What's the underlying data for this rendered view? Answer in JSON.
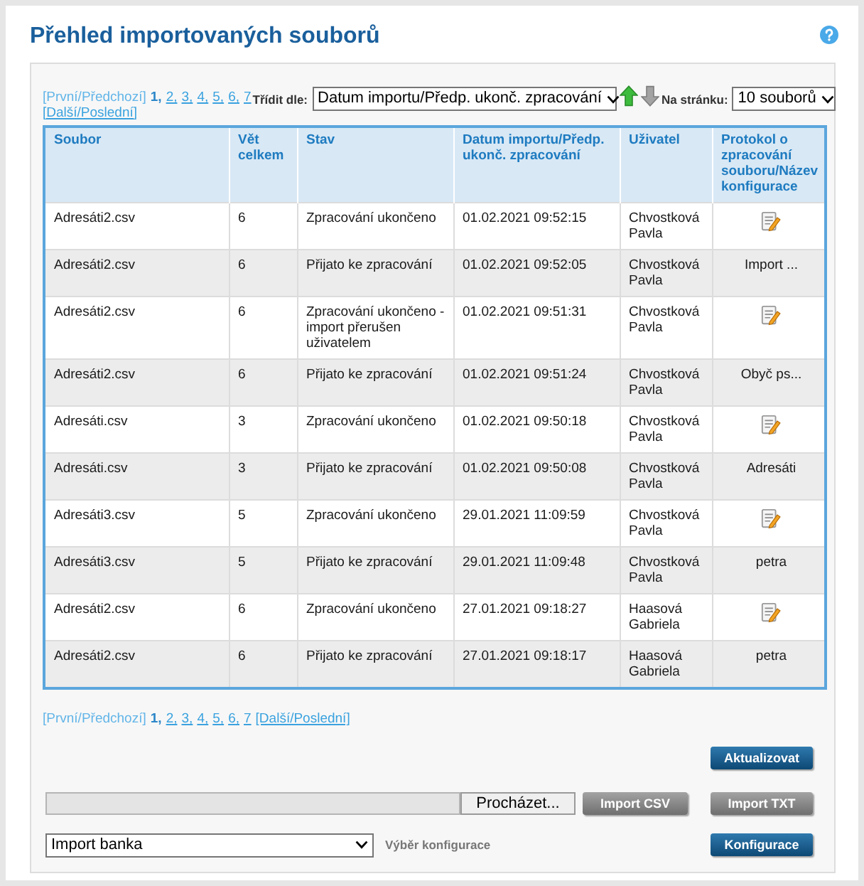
{
  "page": {
    "title": "Přehled importovaných souborů"
  },
  "toolbar": {
    "pagination": {
      "first_prev": {
        "label": "[První/Předchozí]",
        "disabled": true
      },
      "pages": [
        {
          "label": "1,",
          "selected": true
        },
        {
          "label": "2,",
          "selected": false
        },
        {
          "label": "3,",
          "selected": false
        },
        {
          "label": "4,",
          "selected": false
        },
        {
          "label": "5,",
          "selected": false
        },
        {
          "label": "6,",
          "selected": false
        },
        {
          "label": "7",
          "selected": false
        }
      ],
      "next_last": {
        "label": "[Další/Poslední]",
        "disabled": false
      }
    },
    "sort_label": "Třídit dle:",
    "sort_select": {
      "value": "Datum importu/Předp. ukonč. zpracování"
    },
    "sort_buttons": [
      {
        "kind": "up",
        "selected": true
      },
      {
        "kind": "down",
        "selected": false
      }
    ],
    "per_page_label": "Na stránku:",
    "per_page_select": {
      "value": "10 souborů"
    }
  },
  "table": {
    "columns": [
      "Soubor",
      "Vět celkem",
      "Stav",
      "Datum importu/Předp. ukonč. zpracování",
      "Uživatel",
      "Protokol o zpracování souboru/Název konfigurace"
    ],
    "rows": [
      {
        "file": "Adresáti2.csv",
        "records": "6",
        "status": "Zpracování ukončeno",
        "date": "01.02.2021 09:52:15",
        "user": "Chvostková Pavla",
        "protocol": {
          "kind": "icon"
        }
      },
      {
        "file": "Adresáti2.csv",
        "records": "6",
        "status": "Přijato ke zpracování",
        "date": "01.02.2021 09:52:05",
        "user": "Chvostková Pavla",
        "protocol": {
          "kind": "text",
          "text": "Import ..."
        }
      },
      {
        "file": "Adresáti2.csv",
        "records": "6",
        "status": "Zpracování ukončeno - import přerušen uživatelem",
        "date": "01.02.2021 09:51:31",
        "user": "Chvostková Pavla",
        "protocol": {
          "kind": "icon"
        }
      },
      {
        "file": "Adresáti2.csv",
        "records": "6",
        "status": "Přijato ke zpracování",
        "date": "01.02.2021 09:51:24",
        "user": "Chvostková Pavla",
        "protocol": {
          "kind": "text",
          "text": "Obyč ps..."
        }
      },
      {
        "file": "Adresáti.csv",
        "records": "3",
        "status": "Zpracování ukončeno",
        "date": "01.02.2021 09:50:18",
        "user": "Chvostková Pavla",
        "protocol": {
          "kind": "icon"
        }
      },
      {
        "file": "Adresáti.csv",
        "records": "3",
        "status": "Přijato ke zpracování",
        "date": "01.02.2021 09:50:08",
        "user": "Chvostková Pavla",
        "protocol": {
          "kind": "text",
          "text": "Adresáti"
        }
      },
      {
        "file": "Adresáti3.csv",
        "records": "5",
        "status": "Zpracování ukončeno",
        "date": "29.01.2021 11:09:59",
        "user": "Chvostková Pavla",
        "protocol": {
          "kind": "icon"
        }
      },
      {
        "file": "Adresáti3.csv",
        "records": "5",
        "status": "Přijato ke zpracování",
        "date": "29.01.2021 11:09:48",
        "user": "Chvostková Pavla",
        "protocol": {
          "kind": "text",
          "text": "petra"
        }
      },
      {
        "file": "Adresáti2.csv",
        "records": "6",
        "status": "Zpracování ukončeno",
        "date": "27.01.2021 09:18:27",
        "user": "Haasová Gabriela",
        "protocol": {
          "kind": "icon"
        }
      },
      {
        "file": "Adresáti2.csv",
        "records": "6",
        "status": "Přijato ke zpracování",
        "date": "27.01.2021 09:18:17",
        "user": "Haasová Gabriela",
        "protocol": {
          "kind": "text",
          "text": "petra"
        }
      }
    ]
  },
  "pagination_bottom": {
    "first_prev": {
      "label": "[První/Předchozí]",
      "disabled": true
    },
    "pages": [
      {
        "label": "1,",
        "selected": true
      },
      {
        "label": "2,",
        "selected": false
      },
      {
        "label": "3,",
        "selected": false
      },
      {
        "label": "4,",
        "selected": false
      },
      {
        "label": "5,",
        "selected": false
      },
      {
        "label": "6,",
        "selected": false
      },
      {
        "label": "7",
        "selected": false
      }
    ],
    "next_last": {
      "label": "[Další/Poslední]",
      "disabled": false
    }
  },
  "actions": {
    "refresh": {
      "label": "Aktualizovat",
      "disabled": false
    },
    "file_input": {
      "browse_label": "Procházet..."
    },
    "import_buttons": [
      {
        "label": "Import CSV",
        "disabled": true
      },
      {
        "label": "Import TXT",
        "disabled": true
      }
    ],
    "config_select": {
      "value": "Import banka"
    },
    "config_label": "Výběr konfigurace",
    "config_button": {
      "label": "Konfigurace",
      "disabled": false
    }
  }
}
